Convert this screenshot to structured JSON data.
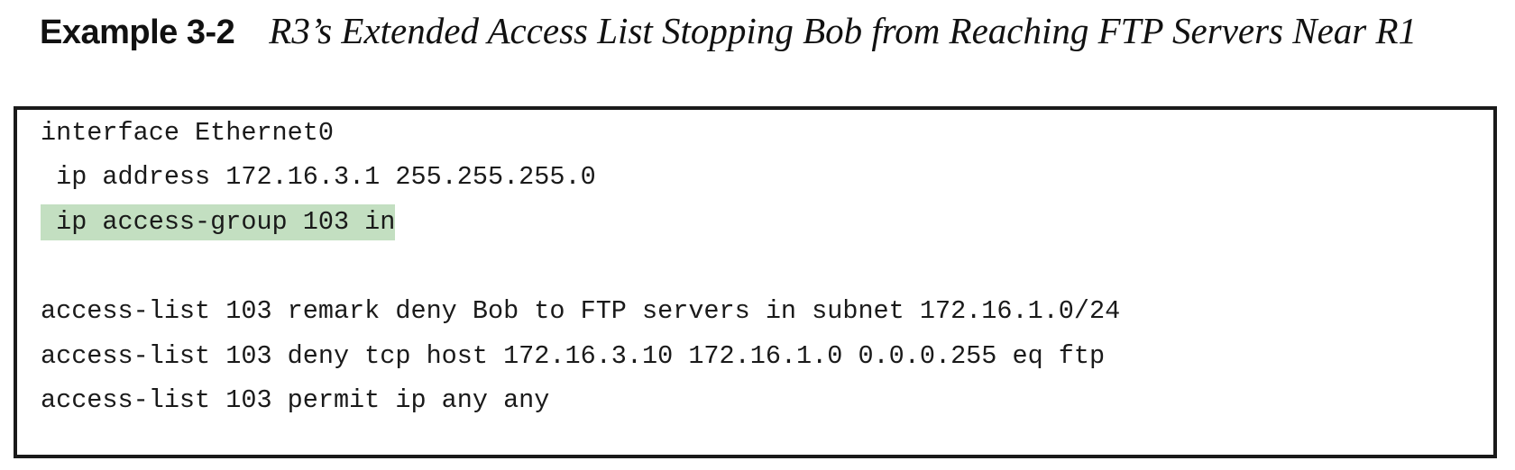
{
  "example": {
    "label": "Example 3-2",
    "caption": "R3’s Extended Access List Stopping Bob from Reaching FTP Servers Near R1"
  },
  "code": {
    "lines": [
      "interface Ethernet0",
      " ip address 172.16.3.1 255.255.255.0",
      " ip access-group 103 in",
      "access-list 103 remark deny Bob to FTP servers in subnet 172.16.1.0/24",
      "access-list 103 deny tcp host 172.16.3.10 172.16.1.0 0.0.0.255 eq ftp",
      "access-list 103 permit ip any any"
    ],
    "highlight_color": "#c3dfc1"
  }
}
